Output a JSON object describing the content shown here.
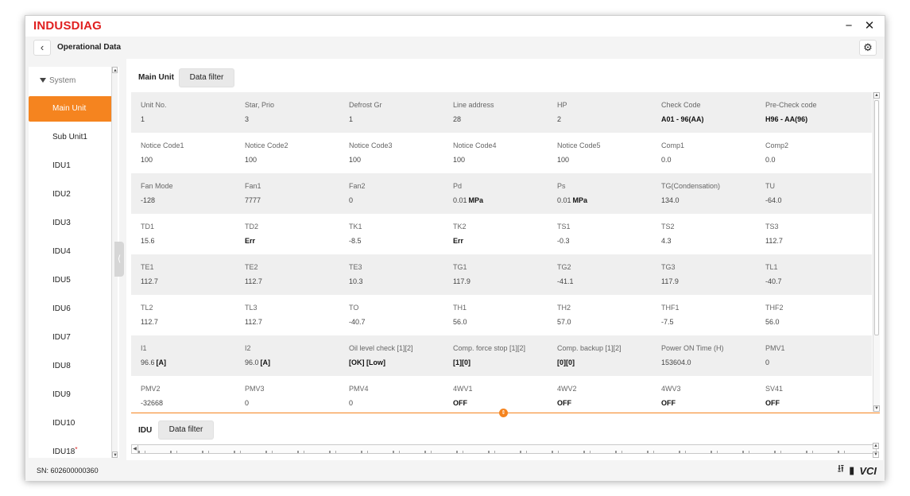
{
  "app": {
    "brand": "INDUSDIAG",
    "minimize": "−",
    "close": "✕"
  },
  "header": {
    "title": "Operational Data"
  },
  "sidebar": {
    "group": "System",
    "items": [
      {
        "label": "Main Unit",
        "active": true
      },
      {
        "label": "Sub Unit1"
      },
      {
        "label": "IDU1"
      },
      {
        "label": "IDU2"
      },
      {
        "label": "IDU3"
      },
      {
        "label": "IDU4"
      },
      {
        "label": "IDU5"
      },
      {
        "label": "IDU6"
      },
      {
        "label": "IDU7"
      },
      {
        "label": "IDU8"
      },
      {
        "label": "IDU9"
      },
      {
        "label": "IDU10"
      },
      {
        "label": "IDU18",
        "marker": "*"
      }
    ]
  },
  "main": {
    "tab": "Main Unit",
    "filter_label": "Data filter",
    "rows": [
      [
        {
          "label": "Unit No.",
          "value": "1"
        },
        {
          "label": "Star, Prio",
          "value": "3"
        },
        {
          "label": "Defrost Gr",
          "value": "1"
        },
        {
          "label": "Line address",
          "value": "28"
        },
        {
          "label": "HP",
          "value": "2"
        },
        {
          "label": "Check Code",
          "value": "A01 - 96(AA)",
          "strong": true
        },
        {
          "label": "Pre-Check code",
          "value": "H96 - AA(96)",
          "strong": true
        }
      ],
      [
        {
          "label": "Notice Code1",
          "value": "100"
        },
        {
          "label": "Notice Code2",
          "value": "100"
        },
        {
          "label": "Notice Code3",
          "value": "100"
        },
        {
          "label": "Notice Code4",
          "value": "100"
        },
        {
          "label": "Notice Code5",
          "value": "100"
        },
        {
          "label": "Comp1",
          "value": "0.0"
        },
        {
          "label": "Comp2",
          "value": "0.0"
        }
      ],
      [
        {
          "label": "Fan Mode",
          "value": "-128"
        },
        {
          "label": "Fan1",
          "value": "7777"
        },
        {
          "label": "Fan2",
          "value": "0"
        },
        {
          "label": "Pd",
          "value": "0.01",
          "unit": "MPa"
        },
        {
          "label": "Ps",
          "value": "0.01",
          "unit": "MPa"
        },
        {
          "label": "TG(Condensation)",
          "value": "134.0"
        },
        {
          "label": "TU",
          "value": "-64.0"
        }
      ],
      [
        {
          "label": "TD1",
          "value": "15.6"
        },
        {
          "label": "TD2",
          "value": "Err",
          "strong": true
        },
        {
          "label": "TK1",
          "value": "-8.5"
        },
        {
          "label": "TK2",
          "value": "Err",
          "strong": true
        },
        {
          "label": "TS1",
          "value": "-0.3"
        },
        {
          "label": "TS2",
          "value": "4.3"
        },
        {
          "label": "TS3",
          "value": "112.7"
        }
      ],
      [
        {
          "label": "TE1",
          "value": "112.7"
        },
        {
          "label": "TE2",
          "value": "112.7"
        },
        {
          "label": "TE3",
          "value": "10.3"
        },
        {
          "label": "TG1",
          "value": "117.9"
        },
        {
          "label": "TG2",
          "value": "-41.1"
        },
        {
          "label": "TG3",
          "value": "117.9"
        },
        {
          "label": "TL1",
          "value": "-40.7"
        }
      ],
      [
        {
          "label": "TL2",
          "value": "112.7"
        },
        {
          "label": "TL3",
          "value": "112.7"
        },
        {
          "label": "TO",
          "value": "-40.7"
        },
        {
          "label": "TH1",
          "value": "56.0"
        },
        {
          "label": "TH2",
          "value": "57.0"
        },
        {
          "label": "THF1",
          "value": "-7.5"
        },
        {
          "label": "THF2",
          "value": "56.0"
        }
      ],
      [
        {
          "label": "I1",
          "value": "96.6",
          "unit": "[A]"
        },
        {
          "label": "I2",
          "value": "96.0",
          "unit": "[A]"
        },
        {
          "label": "Oil level check [1][2]",
          "value": "[OK] [Low]",
          "strong": true
        },
        {
          "label": "Comp. force stop [1][2]",
          "value": "[1][0]",
          "strong": true
        },
        {
          "label": "Comp. backup [1][2]",
          "value": "[0][0]",
          "strong": true
        },
        {
          "label": "Power ON Time (H)",
          "value": "153604.0"
        },
        {
          "label": "PMV1",
          "value": "0"
        }
      ],
      [
        {
          "label": "PMV2",
          "value": "-32668"
        },
        {
          "label": "PMV3",
          "value": "0"
        },
        {
          "label": "PMV4",
          "value": "0"
        },
        {
          "label": "4WV1",
          "value": "OFF",
          "strong": true
        },
        {
          "label": "4WV2",
          "value": "OFF",
          "strong": true
        },
        {
          "label": "4WV3",
          "value": "OFF",
          "strong": true
        },
        {
          "label": "SV41",
          "value": "OFF",
          "strong": true
        }
      ]
    ]
  },
  "bottom": {
    "tab": "IDU",
    "filter_label": "Data filter"
  },
  "status": {
    "serial": "SN: 602600000360",
    "vci_label": "VCI"
  },
  "colors": {
    "brand": "#e02020",
    "accent": "#f5841f"
  },
  "icons": [
    "back-icon",
    "gear-icon",
    "usb-icon",
    "battery-icon",
    "vci-icon",
    "minimize-icon",
    "close-icon",
    "chevron-left-icon",
    "splitter-icon"
  ]
}
